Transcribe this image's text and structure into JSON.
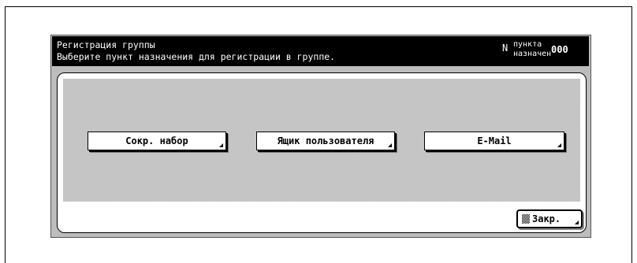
{
  "dialog": {
    "title": "Регистрация группы",
    "instruction": "Выберите пункт назначения для регистрации в группе.",
    "counter": {
      "prefix": "N",
      "label_top": "пункта",
      "count": "000",
      "label_bottom": "назначен"
    }
  },
  "options": {
    "abbr_dial": "Сокр. набор",
    "user_box": "Ящик пользователя",
    "email": "E-Mail"
  },
  "footer": {
    "close_label": "Закр."
  },
  "icons": [
    "corner-arrow-icon",
    "close-pattern-icon"
  ]
}
